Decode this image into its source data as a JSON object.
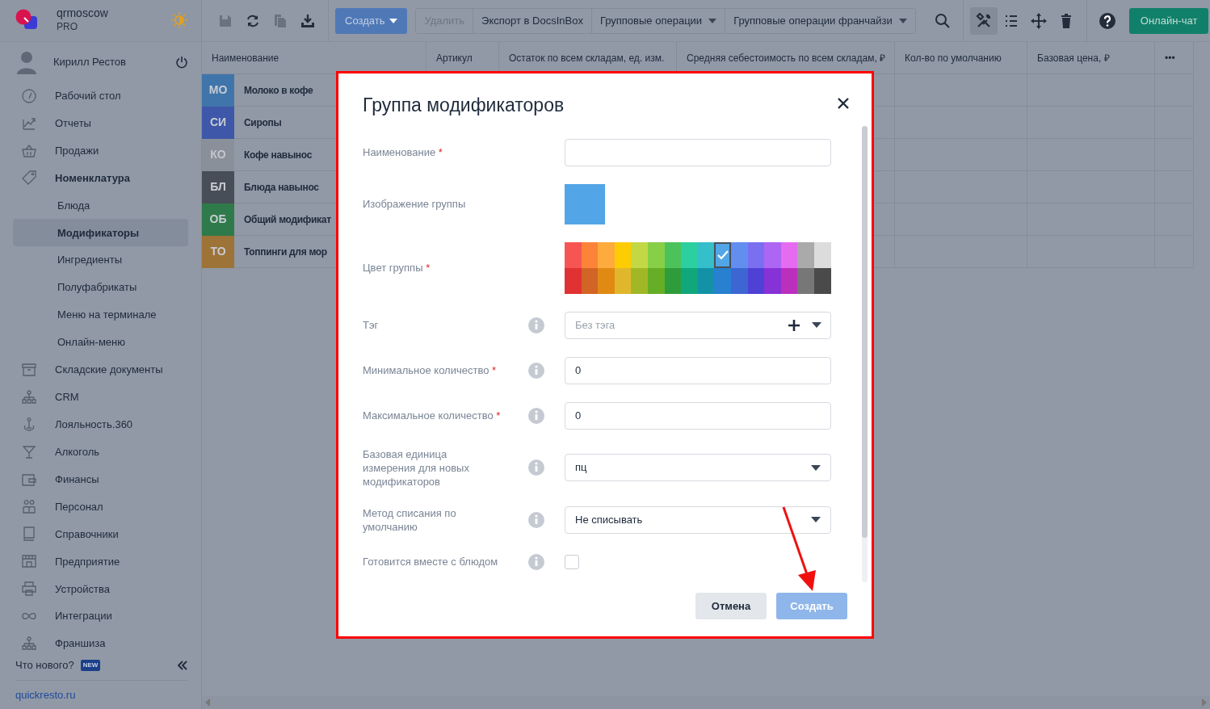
{
  "sidebar": {
    "brand": "qrmoscow",
    "plan": "PRO",
    "user": "Кирилл Рестов",
    "items": [
      {
        "label": "Рабочий стол",
        "expanded": false,
        "selected": false
      },
      {
        "label": "Отчеты",
        "expanded": false,
        "selected": false
      },
      {
        "label": "Продажи",
        "expanded": false,
        "selected": false
      },
      {
        "label": "Номенклатура",
        "expanded": true,
        "selected": false,
        "children": [
          {
            "label": "Блюда",
            "selected": false
          },
          {
            "label": "Модификаторы",
            "selected": true
          },
          {
            "label": "Ингредиенты",
            "selected": false
          },
          {
            "label": "Полуфабрикаты",
            "selected": false
          },
          {
            "label": "Меню на терминале",
            "selected": false
          },
          {
            "label": "Онлайн-меню",
            "selected": false
          }
        ]
      },
      {
        "label": "Складские документы",
        "expanded": false,
        "selected": false
      },
      {
        "label": "CRM",
        "expanded": false,
        "selected": false
      },
      {
        "label": "Лояльность.360",
        "expanded": false,
        "selected": false
      },
      {
        "label": "Алкоголь",
        "expanded": false,
        "selected": false
      },
      {
        "label": "Финансы",
        "expanded": false,
        "selected": false
      },
      {
        "label": "Персонал",
        "expanded": false,
        "selected": false
      },
      {
        "label": "Справочники",
        "expanded": false,
        "selected": false
      },
      {
        "label": "Предприятие",
        "expanded": false,
        "selected": false
      },
      {
        "label": "Устройства",
        "expanded": false,
        "selected": false
      },
      {
        "label": "Интеграции",
        "expanded": false,
        "selected": false
      },
      {
        "label": "Франшиза",
        "expanded": false,
        "selected": false
      }
    ],
    "whats_new": "Что нового?",
    "new_badge": "NEW",
    "link": "quickresto.ru"
  },
  "toolbar": {
    "file_buttons": [
      {
        "disabled": true
      },
      {
        "disabled": false
      },
      {
        "disabled": true
      },
      {
        "disabled": false
      }
    ],
    "create_button": "Создать",
    "actions": [
      {
        "label": "Удалить",
        "disabled": true,
        "dropdown": false
      },
      {
        "label": "Экспорт в DocsInBox",
        "disabled": false,
        "dropdown": false
      },
      {
        "label": "Групповые операции",
        "disabled": false,
        "dropdown": true
      },
      {
        "label": "Групповые операции франчайзи",
        "disabled": false,
        "dropdown": true
      }
    ],
    "view_buttons": [
      {
        "selected": true
      },
      {
        "selected": false
      },
      {
        "selected": false
      },
      {
        "selected": false
      }
    ],
    "chat_button": "Онлайн-чат"
  },
  "table": {
    "columns": [
      "Наименование",
      "Артикул",
      "Остаток по всем складам, ед. изм.",
      "Средняя себестоимость по всем складам, ₽",
      "Кол-во по умолчанию",
      "Базовая цена, ₽",
      "•••"
    ],
    "rows": [
      {
        "badge": "МО",
        "color": "#3f75aa",
        "name": "Молоко в кофе"
      },
      {
        "badge": "СИ",
        "color": "#3e57a8",
        "name": "Сиропы"
      },
      {
        "badge": "КО",
        "color": "#8a9099",
        "name": "Кофе навынос"
      },
      {
        "badge": "БЛ",
        "color": "#484e58",
        "name": "Блюда навынос"
      },
      {
        "badge": "ОБ",
        "color": "#2f7a4a",
        "name": "Общий модификат"
      },
      {
        "badge": "ТО",
        "color": "#9d7338",
        "name": "Топпинги для мор"
      }
    ]
  },
  "dialog": {
    "title": "Группа модификаторов",
    "fields": [
      {
        "kind": "text",
        "label": "Наименование",
        "required_mark": "*",
        "info": false
      },
      {
        "kind": "image",
        "label": "Изображение группы",
        "info": false,
        "color": "#52a5e6"
      },
      {
        "kind": "palette",
        "label": "Цвет группы",
        "required_mark": "*",
        "info": false,
        "swatches": [
          {
            "color": "#f65554",
            "selected": false
          },
          {
            "color": "#fd8338",
            "selected": false
          },
          {
            "color": "#fdab3c",
            "selected": false
          },
          {
            "color": "#fdcc02",
            "selected": false
          },
          {
            "color": "#c2d845",
            "selected": false
          },
          {
            "color": "#88cf48",
            "selected": false
          },
          {
            "color": "#4bc35a",
            "selected": false
          },
          {
            "color": "#2ccf9f",
            "selected": false
          },
          {
            "color": "#34bfcb",
            "selected": false
          },
          {
            "color": "#52a5e6",
            "selected": true
          },
          {
            "color": "#628ef0",
            "selected": false
          },
          {
            "color": "#7a6ff0",
            "selected": false
          },
          {
            "color": "#ad66f3",
            "selected": false
          },
          {
            "color": "#e56cf0",
            "selected": false
          },
          {
            "color": "#aaaaaa",
            "selected": false
          },
          {
            "color": "#dcdcdc",
            "selected": false
          },
          {
            "color": "#e03232",
            "selected": false
          },
          {
            "color": "#d26425",
            "selected": false
          },
          {
            "color": "#e08a13",
            "selected": false
          },
          {
            "color": "#e0b72c",
            "selected": false
          },
          {
            "color": "#a1b826",
            "selected": false
          },
          {
            "color": "#66ae26",
            "selected": false
          },
          {
            "color": "#2f9c3c",
            "selected": false
          },
          {
            "color": "#10a77b",
            "selected": false
          },
          {
            "color": "#1392a7",
            "selected": false
          },
          {
            "color": "#2780d0",
            "selected": false
          },
          {
            "color": "#3d66d2",
            "selected": false
          },
          {
            "color": "#4f40d6",
            "selected": false
          },
          {
            "color": "#8732d6",
            "selected": false
          },
          {
            "color": "#bb2fbd",
            "selected": false
          },
          {
            "color": "#777777",
            "selected": false
          },
          {
            "color": "#4a4a4a",
            "selected": false
          }
        ]
      },
      {
        "kind": "tag",
        "label": "Тэг",
        "info": true,
        "placeholder": "Без тэга"
      },
      {
        "kind": "number",
        "label": "Минимальное количество",
        "required_mark": "*",
        "info": true,
        "value": "0"
      },
      {
        "kind": "number",
        "label": "Максимальное количество",
        "required_mark": "*",
        "info": true,
        "value": "0"
      },
      {
        "kind": "select",
        "label": "Базовая единица измерения для новых модификаторов",
        "info": true,
        "value": "пц"
      },
      {
        "kind": "select",
        "label": "Метод списания по умолчанию",
        "info": true,
        "value": "Не списывать"
      },
      {
        "kind": "checkbox",
        "label": "Готовится вместе с блюдом",
        "info": true,
        "checked": false
      }
    ],
    "cancel_button": "Отмена",
    "submit": {
      "label": "Создать",
      "disabled": true
    }
  }
}
